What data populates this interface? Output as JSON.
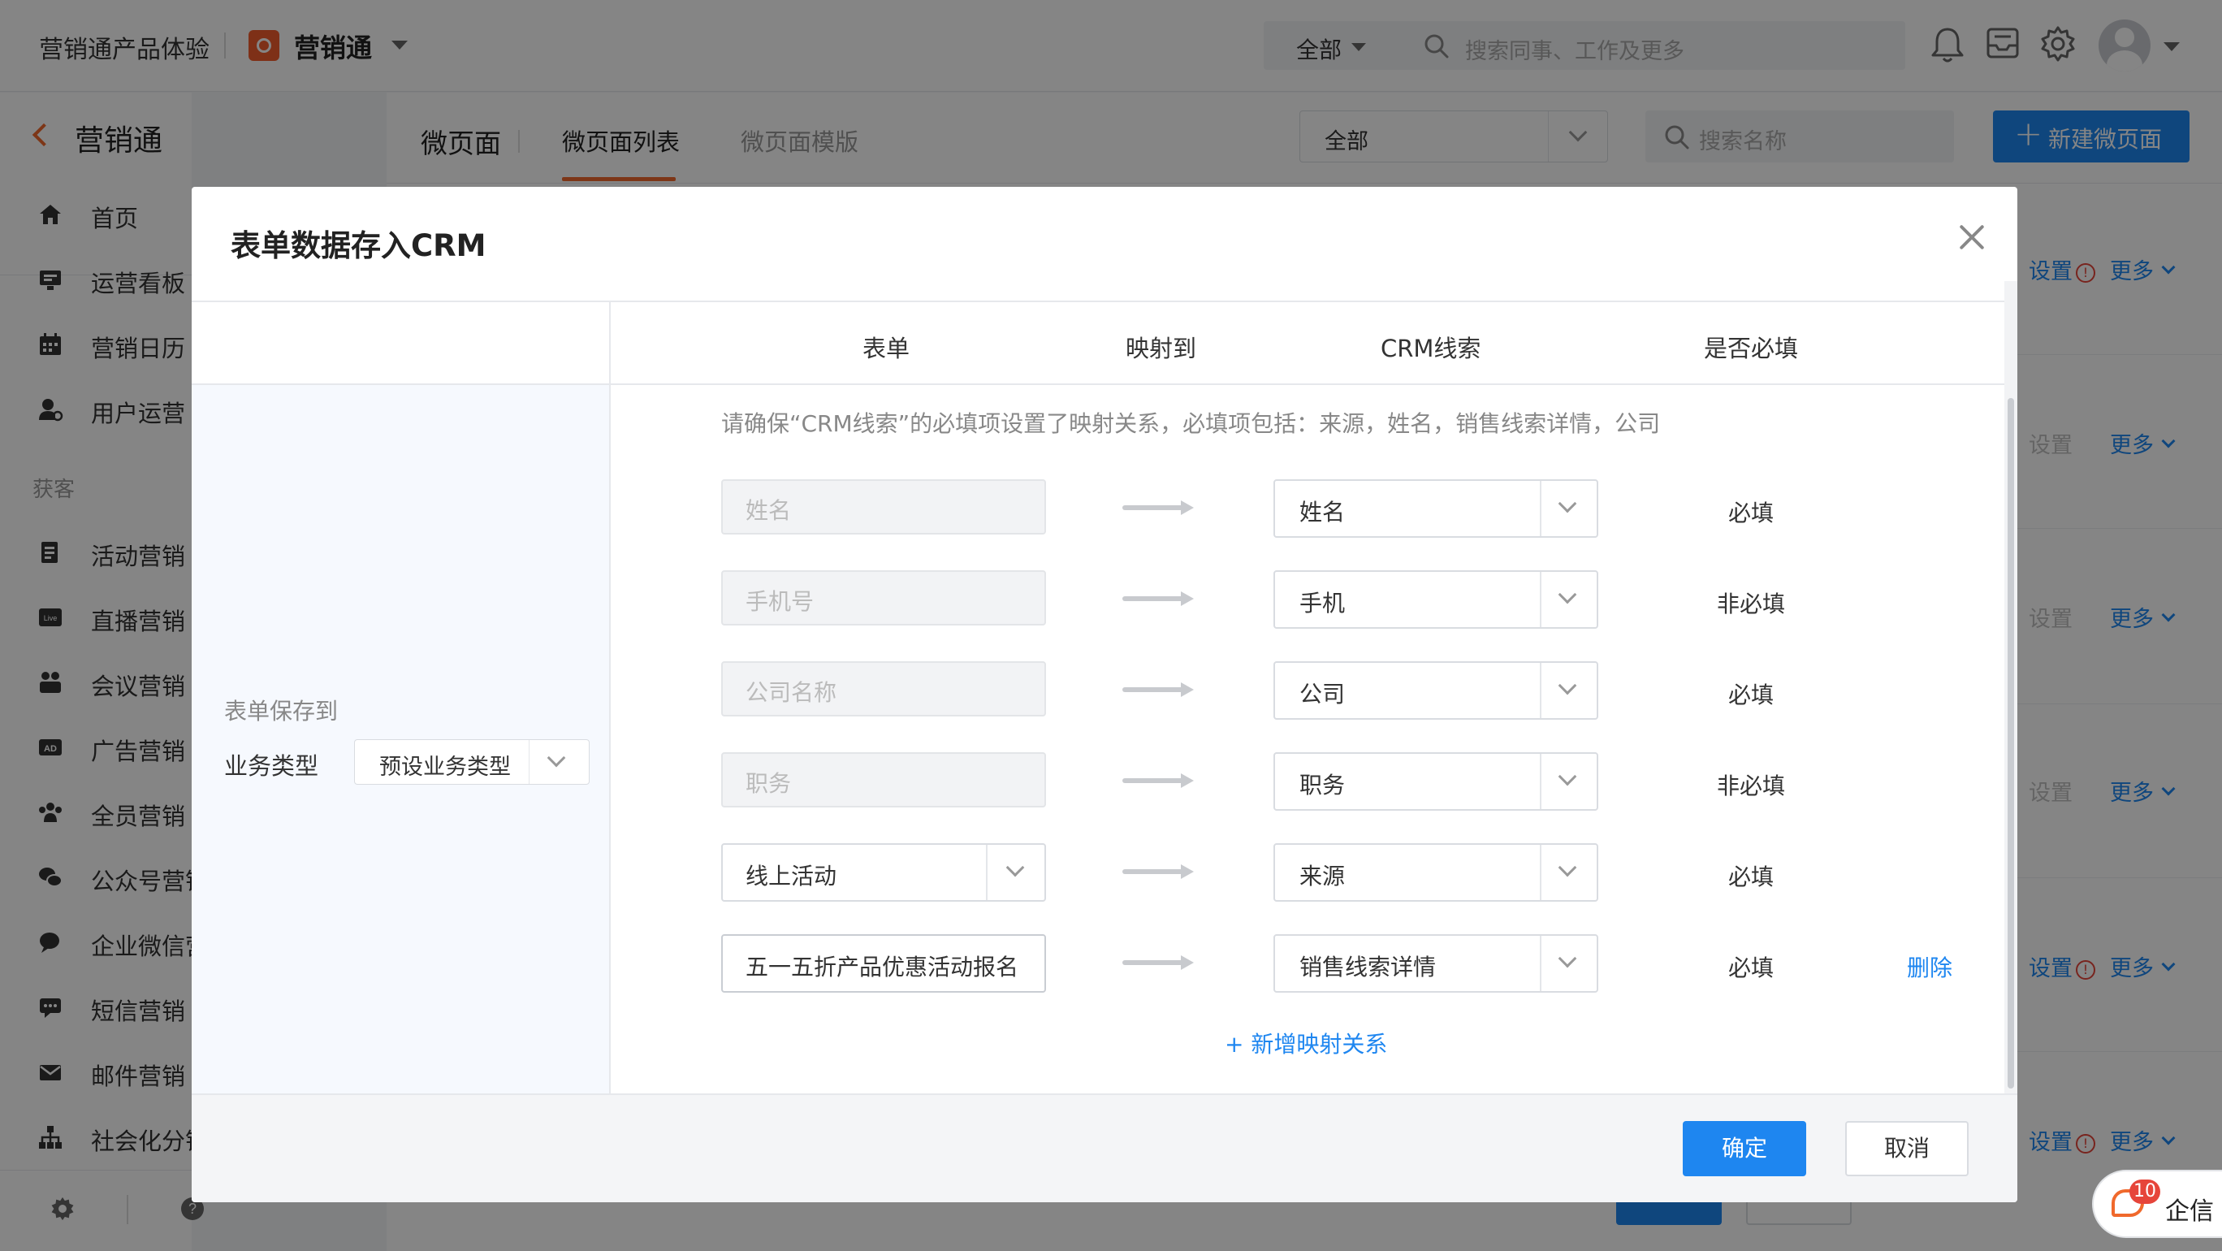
{
  "topbar": {
    "product": "营销通产品体验",
    "brand": "营销通",
    "search_scope": "全部",
    "search_placeholder": "搜索同事、工作及更多"
  },
  "sidebar": {
    "back_label": "营销通",
    "group_label": "获客",
    "items": [
      {
        "label": "首页",
        "icon": "home-icon"
      },
      {
        "label": "运营看板",
        "icon": "dashboard-icon"
      },
      {
        "label": "营销日历",
        "icon": "calendar-icon"
      },
      {
        "label": "用户运营",
        "icon": "user-ops-icon"
      },
      {
        "label": "活动营销",
        "icon": "activity-icon"
      },
      {
        "label": "直播营销",
        "icon": "live-icon"
      },
      {
        "label": "会议营销",
        "icon": "meeting-icon"
      },
      {
        "label": "广告营销",
        "icon": "ad-icon"
      },
      {
        "label": "全员营销",
        "icon": "team-icon"
      },
      {
        "label": "公众号营销",
        "icon": "wechat-icon"
      },
      {
        "label": "企业微信营",
        "icon": "wecom-icon"
      },
      {
        "label": "短信营销",
        "icon": "sms-icon"
      },
      {
        "label": "邮件营销",
        "icon": "mail-icon"
      },
      {
        "label": "社会化分销",
        "icon": "distribution-icon"
      }
    ]
  },
  "page": {
    "title": "微页面",
    "tabs": [
      "微页面列表",
      "微页面模版"
    ],
    "filter_value": "全部",
    "name_search_placeholder": "搜索名称",
    "new_button": "新建微页面",
    "row_actions": {
      "settings": "设置",
      "more": "更多"
    },
    "rows": [
      {
        "settings_warning": true,
        "settings_enabled": true
      },
      {
        "settings_warning": false,
        "settings_enabled": false
      },
      {
        "settings_warning": false,
        "settings_enabled": false
      },
      {
        "settings_warning": false,
        "settings_enabled": false
      },
      {
        "settings_warning": true,
        "settings_enabled": true
      },
      {
        "settings_warning": true,
        "settings_enabled": true
      }
    ]
  },
  "chat": {
    "badge": "10",
    "label": "企信"
  },
  "modal": {
    "title": "表单数据存入CRM",
    "columns": [
      "表单",
      "映射到",
      "CRM线索",
      "是否必填"
    ],
    "save_to_label": "表单保存到",
    "business_type_label": "业务类型",
    "business_type_value": "预设业务类型",
    "hint": "请确保“CRM线索”的必填项设置了映射关系，必填项包括：来源，姓名，销售线索详情，公司",
    "mappings": [
      {
        "source": "姓名",
        "source_kind": "disabled",
        "target": "姓名",
        "required": "必填"
      },
      {
        "source": "手机号",
        "source_kind": "disabled",
        "target": "手机",
        "required": "非必填"
      },
      {
        "source": "公司名称",
        "source_kind": "disabled",
        "target": "公司",
        "required": "必填"
      },
      {
        "source": "职务",
        "source_kind": "disabled",
        "target": "职务",
        "required": "非必填"
      },
      {
        "source": "线上活动",
        "source_kind": "select",
        "target": "来源",
        "required": "必填"
      },
      {
        "source": "五一五折产品优惠活动报名",
        "source_kind": "text",
        "target": "销售线索详情",
        "required": "必填",
        "delete": "删除"
      }
    ],
    "add_mapping": "+ 新增映射关系",
    "confirm": "确定",
    "cancel": "取消"
  },
  "colors": {
    "accent": "#1e86f0",
    "brand": "#f0692c",
    "warning": "#e6453a"
  }
}
